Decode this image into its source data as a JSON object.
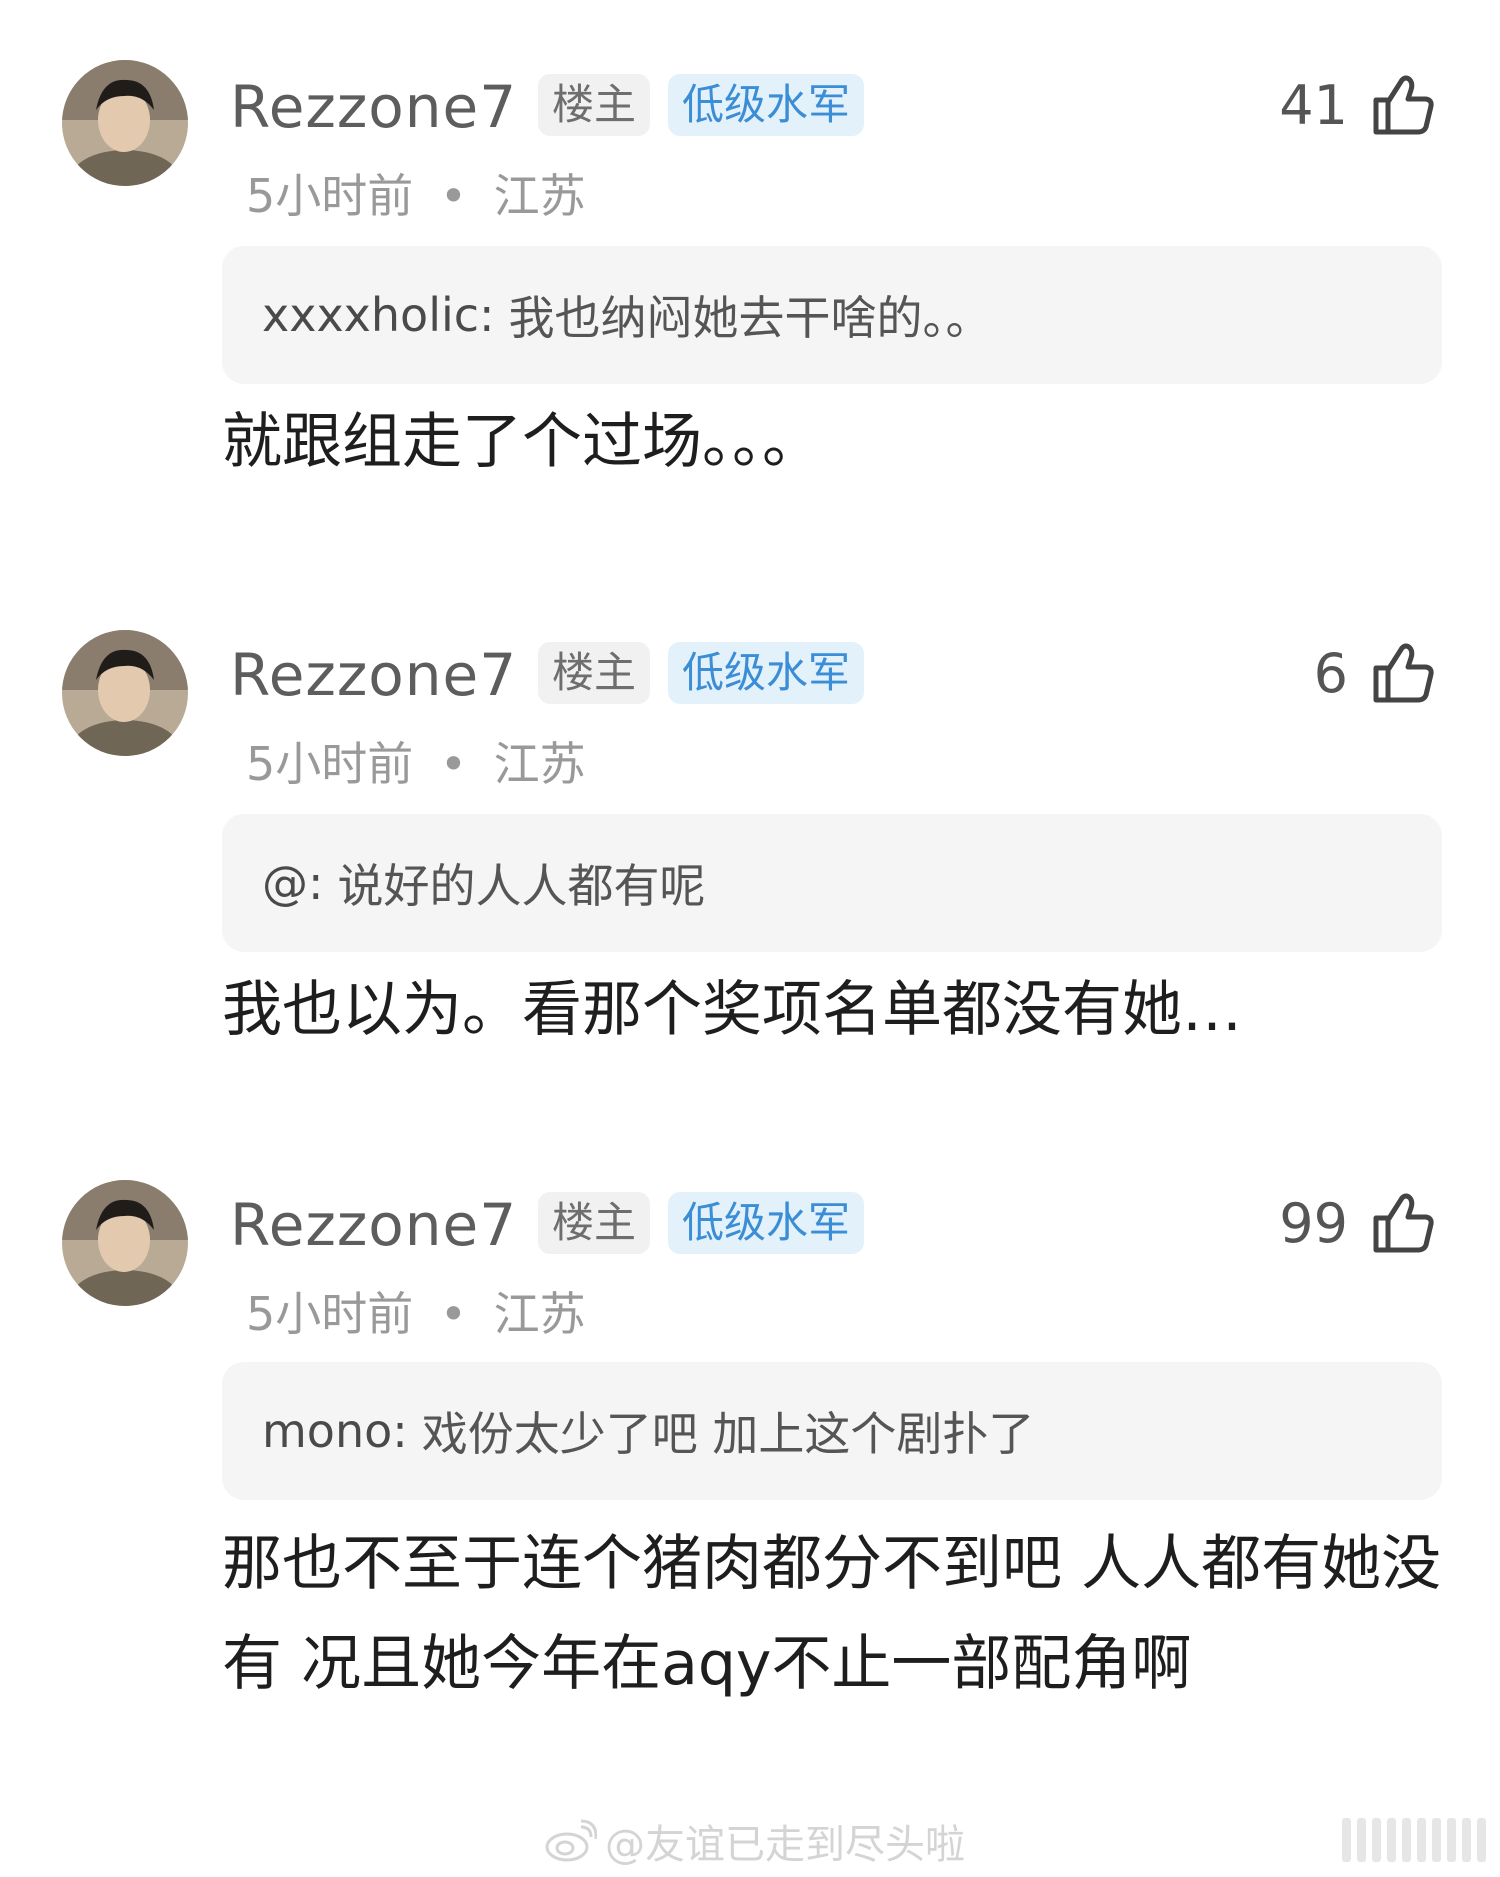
{
  "comments": [
    {
      "username": "Rezzone7",
      "badge_op": "楼主",
      "badge_level": "低级水军",
      "like_count": "41",
      "time": "5小时前",
      "dot": "•",
      "location": "江苏",
      "quote_name": "xxxxholic:",
      "quote_text": "我也纳闷她去干啥的。。",
      "body": "就跟组走了个过场。。。"
    },
    {
      "username": "Rezzone7",
      "badge_op": "楼主",
      "badge_level": "低级水军",
      "like_count": "6",
      "time": "5小时前",
      "dot": "•",
      "location": "江苏",
      "quote_name": "@:",
      "quote_text": "说好的人人都有呢",
      "body": "我也以为。看那个奖项名单都没有她…"
    },
    {
      "username": "Rezzone7",
      "badge_op": "楼主",
      "badge_level": "低级水军",
      "like_count": "99",
      "time": "5小时前",
      "dot": "•",
      "location": "江苏",
      "quote_name": "mono:",
      "quote_text": "戏份太少了吧 加上这个剧扑了",
      "body": "那也不至于连个猪肉都分不到吧 人人都有她没有 况且她今年在aqy不止一部配角啊"
    }
  ],
  "watermark": {
    "text": "@友谊已走到尽头啦",
    "icon": "weibo-logo-icon"
  },
  "colors": {
    "badge_level_bg": "#e3f1fb",
    "badge_level_text": "#3b8ed6",
    "quote_bg": "#f5f5f5"
  }
}
